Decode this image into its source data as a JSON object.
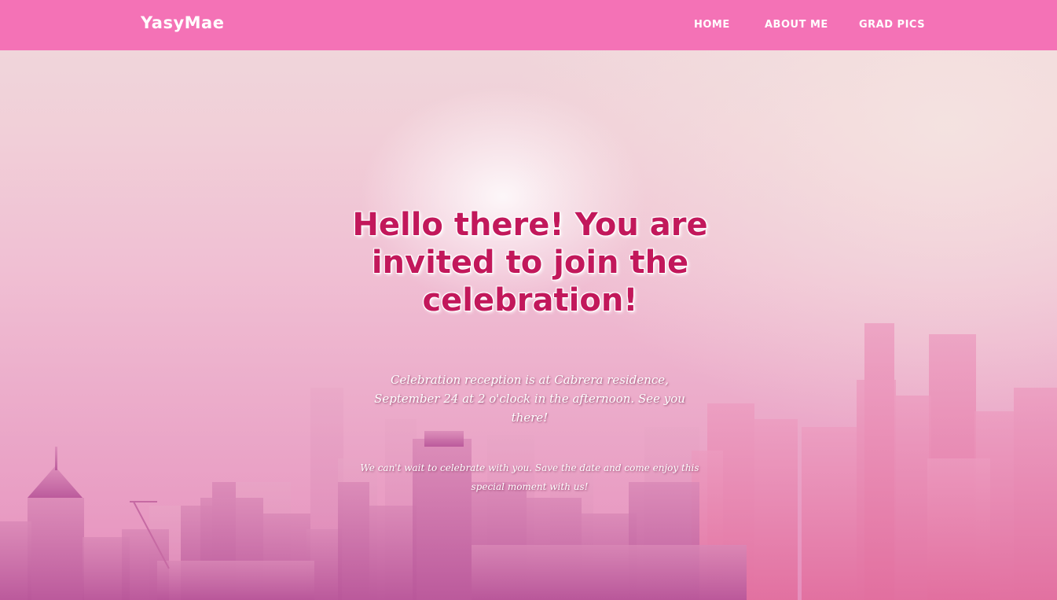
{
  "navbar": {
    "brand": "YasyMae",
    "links": [
      {
        "label": "HOME"
      },
      {
        "label": "ABOUT ME"
      },
      {
        "label": "GRAD PICS"
      }
    ],
    "background_color": "#f472b6"
  },
  "hero": {
    "headline": "Hello there! You are invited to join the celebration!",
    "details": "Celebration reception is at Cabrera residence, September 24 at 2 o'clock in the afternoon. See you there!",
    "tagline": "We can't wait to celebrate with you. Save the date and come enjoy this special moment with us!",
    "headline_color": "#c2185b",
    "background": "pink-tinted city skyline in haze"
  }
}
